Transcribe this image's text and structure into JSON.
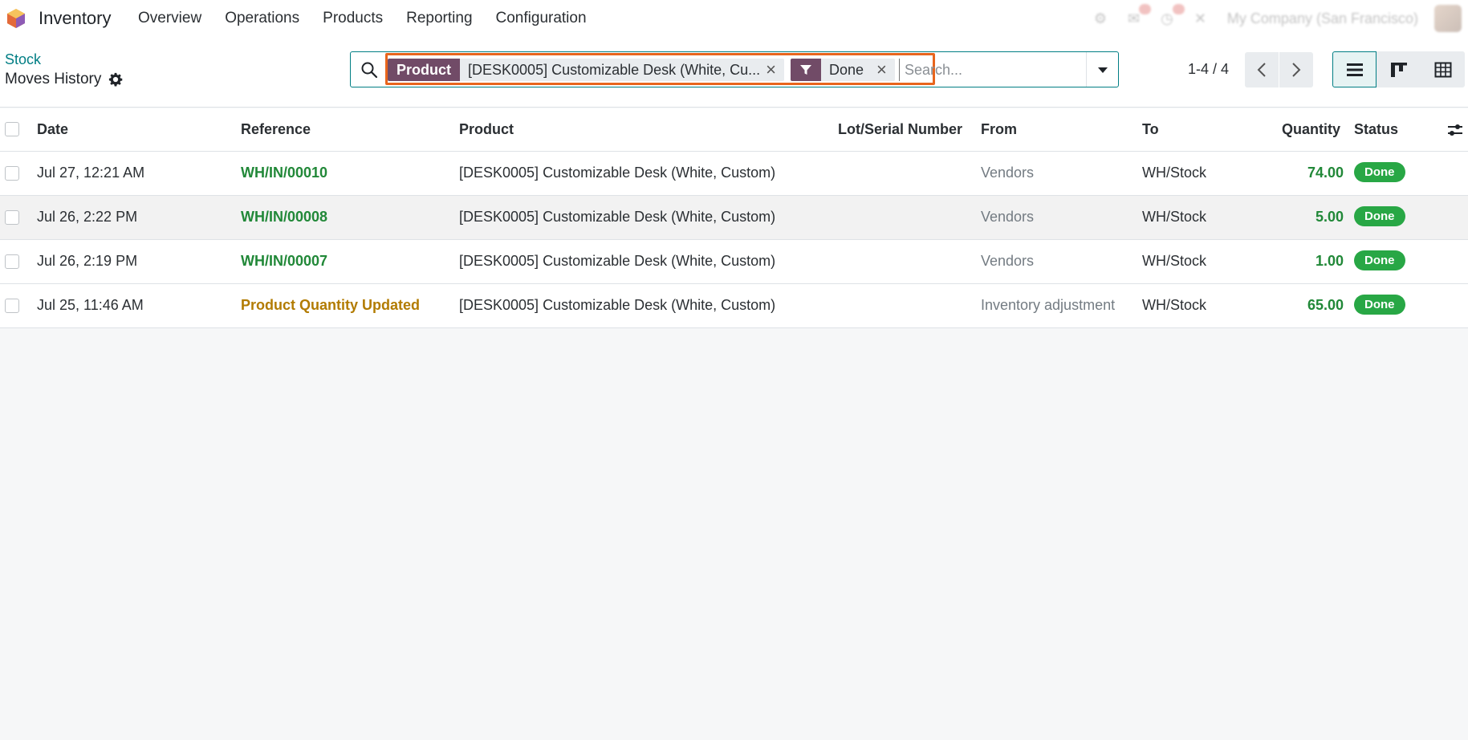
{
  "navbar": {
    "app_name": "Inventory",
    "menu": [
      "Overview",
      "Operations",
      "Products",
      "Reporting",
      "Configuration"
    ],
    "company": "My Company (San Francisco)"
  },
  "control": {
    "breadcrumb": "Stock",
    "title": "Moves History",
    "search": {
      "facets": [
        {
          "label": "Product",
          "value": "[DESK0005] Customizable Desk (White, Cu..."
        },
        {
          "label": "filter-icon",
          "value": "Done"
        }
      ],
      "placeholder": "Search..."
    },
    "pager": "1-4 / 4"
  },
  "table": {
    "columns": [
      "Date",
      "Reference",
      "Product",
      "Lot/Serial Number",
      "From",
      "To",
      "Quantity",
      "Status"
    ],
    "rows": [
      {
        "date": "Jul 27, 12:21 AM",
        "reference": "WH/IN/00010",
        "product": "[DESK0005] Customizable Desk (White, Custom)",
        "lot": "",
        "from": "Vendors",
        "to": "WH/Stock",
        "quantity": "74.00",
        "status": "Done"
      },
      {
        "date": "Jul 26, 2:22 PM",
        "reference": "WH/IN/00008",
        "product": "[DESK0005] Customizable Desk (White, Custom)",
        "lot": "",
        "from": "Vendors",
        "to": "WH/Stock",
        "quantity": "5.00",
        "status": "Done"
      },
      {
        "date": "Jul 26, 2:19 PM",
        "reference": "WH/IN/00007",
        "product": "[DESK0005] Customizable Desk (White, Custom)",
        "lot": "",
        "from": "Vendors",
        "to": "WH/Stock",
        "quantity": "1.00",
        "status": "Done"
      },
      {
        "date": "Jul 25, 11:46 AM",
        "reference": "Product Quantity Updated",
        "product": "[DESK0005] Customizable Desk (White, Custom)",
        "lot": "",
        "from": "Inventory adjustment",
        "to": "WH/Stock",
        "quantity": "65.00",
        "status": "Done"
      }
    ]
  },
  "colors": {
    "brand": "#714b67",
    "accent": "#017e84",
    "link_green": "#218838",
    "adjust_gold": "#b27b00",
    "badge_green": "#28a745",
    "highlight": "#e8651d"
  }
}
